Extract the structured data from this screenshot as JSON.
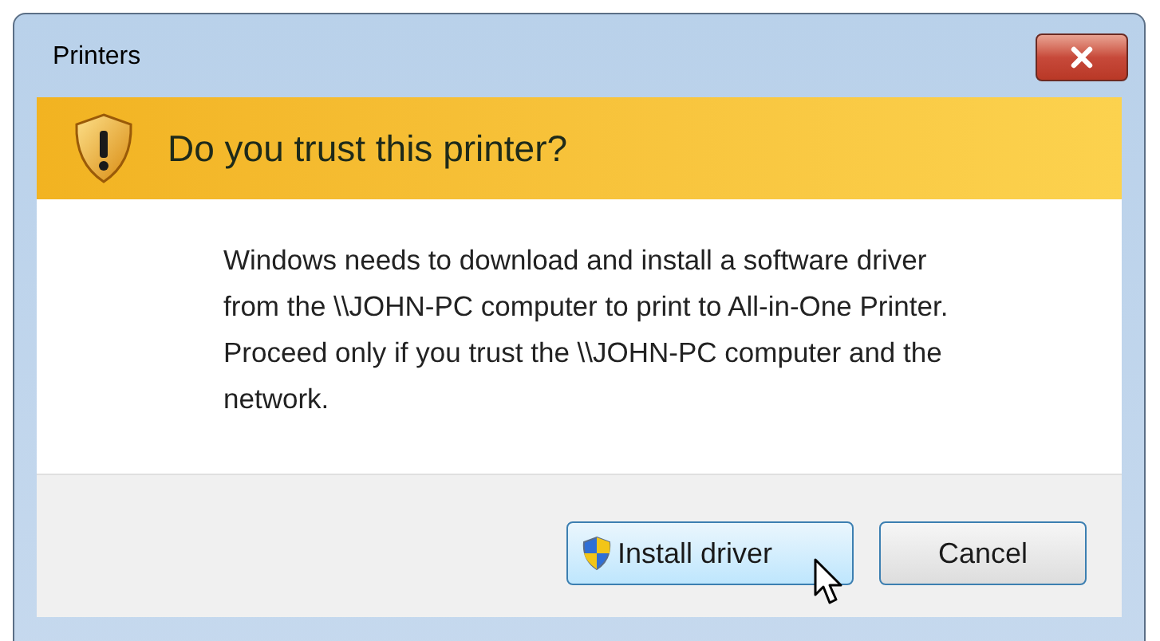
{
  "window": {
    "title": "Printers"
  },
  "banner": {
    "heading": "Do you trust this printer?"
  },
  "message": "Windows needs to download and install a software driver from the \\\\JOHN-PC computer to print to All-in-One Printer.  Proceed only if you trust the \\\\JOHN-PC computer and the network.",
  "buttons": [
    {
      "label": "Install driver",
      "kind": "elevated",
      "hovered": true
    },
    {
      "label": "Cancel",
      "kind": "plain",
      "hovered": false
    }
  ]
}
